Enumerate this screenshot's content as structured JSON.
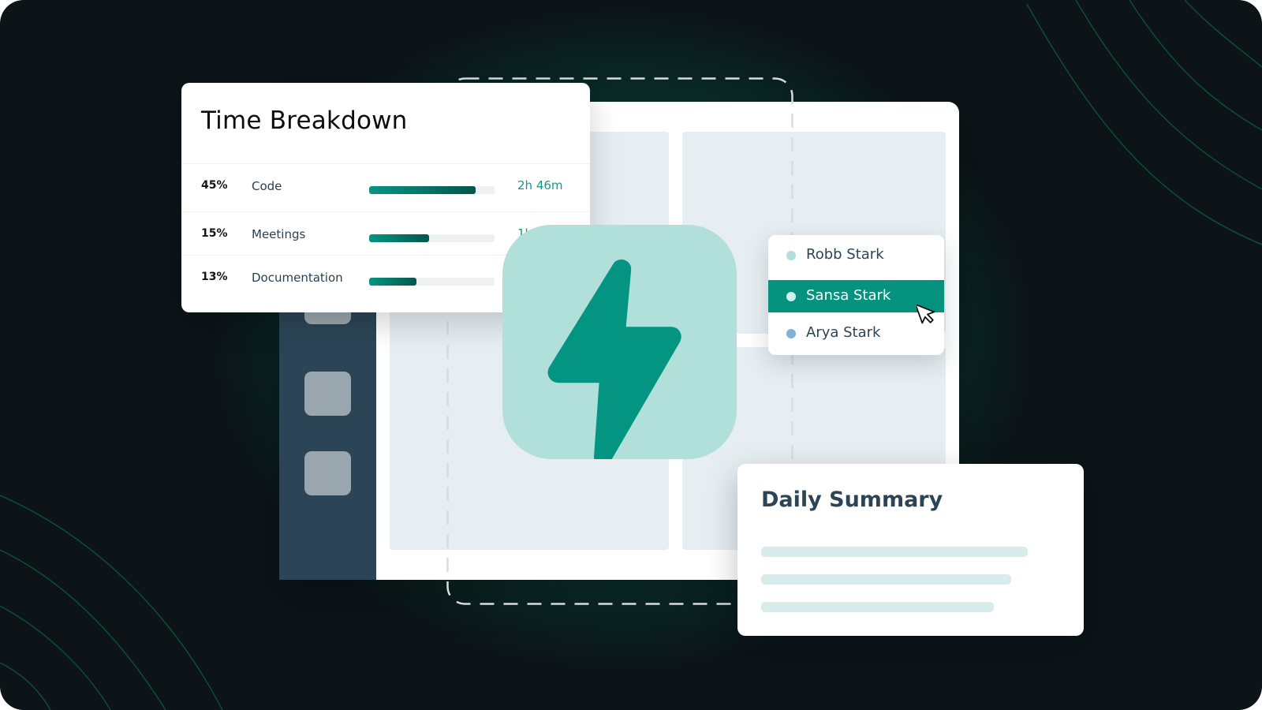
{
  "colors": {
    "background": "#0c1418",
    "glow": "#0a7a68",
    "accent": "#05937f",
    "accent_light": "#b1dfd9",
    "sidebar": "#2c4556",
    "panel": "#e7eef2",
    "text_dark": "#2c4556"
  },
  "time_breakdown": {
    "title": "Time Breakdown",
    "rows": [
      {
        "percent": "45%",
        "label": "Code",
        "time": "2h 46m",
        "bar_fill": 0.85
      },
      {
        "percent": "15%",
        "label": "Meetings",
        "time": "1h",
        "bar_fill": 0.48
      },
      {
        "percent": "13%",
        "label": "Documentation",
        "time": "",
        "bar_fill": 0.38
      }
    ]
  },
  "app_icon": {
    "icon": "lightning-bolt-icon"
  },
  "user_dropdown": {
    "items": [
      {
        "name": "Robb Stark",
        "dot_color": "#b1dfd9",
        "selected": false
      },
      {
        "name": "Sansa Stark",
        "dot_color": "#d4f0ec",
        "selected": true
      },
      {
        "name": "Arya Stark",
        "dot_color": "#7fb0d6",
        "selected": false
      }
    ]
  },
  "daily_summary": {
    "title": "Daily Summary",
    "placeholder_lines": 3
  },
  "sidebar": {
    "buttons": 3
  }
}
